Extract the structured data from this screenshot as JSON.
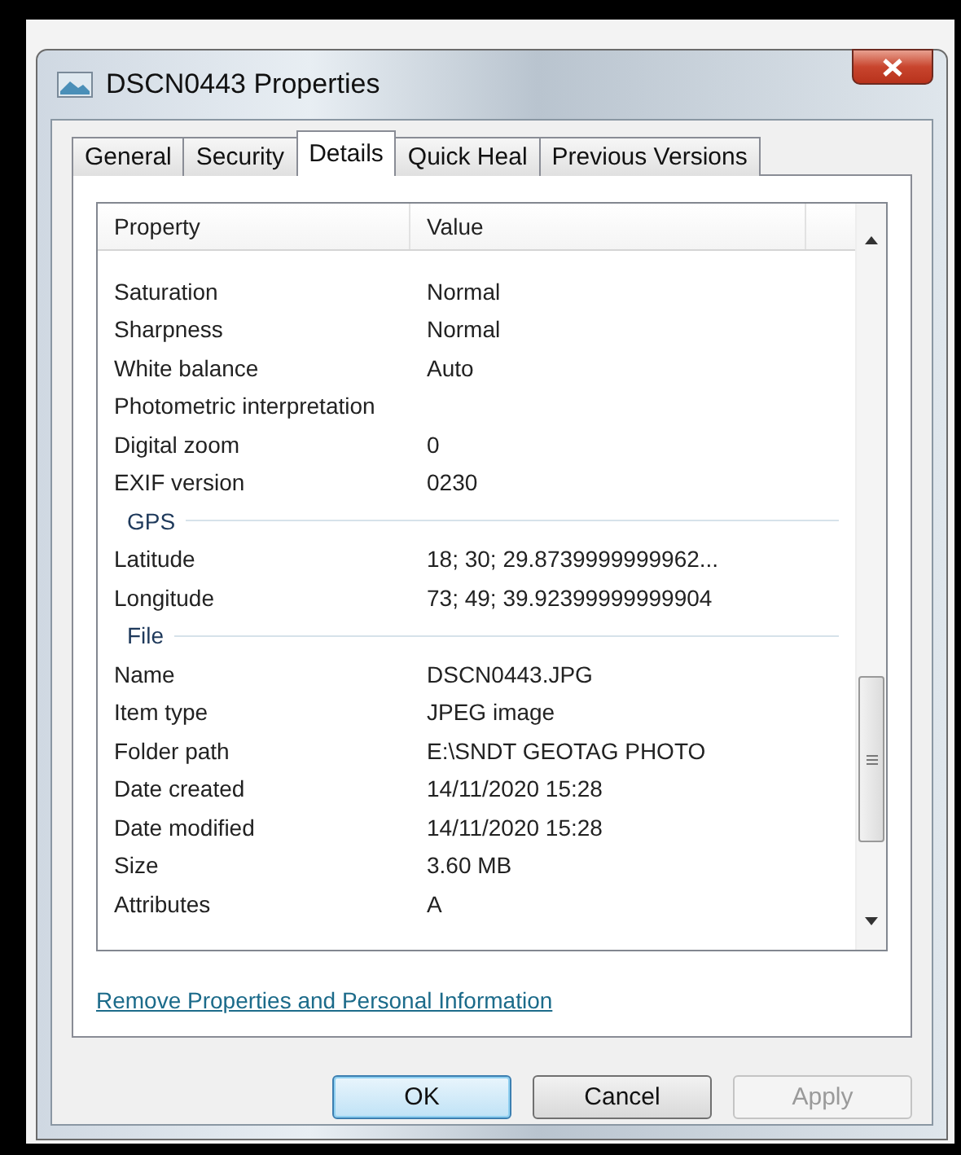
{
  "window": {
    "title": "DSCN0443 Properties"
  },
  "tabs": [
    {
      "label": "General",
      "selected": false
    },
    {
      "label": "Security",
      "selected": false
    },
    {
      "label": "Details",
      "selected": true
    },
    {
      "label": "Quick Heal",
      "selected": false
    },
    {
      "label": "Previous Versions",
      "selected": false
    }
  ],
  "table": {
    "columns": [
      "Property",
      "Value"
    ],
    "rows": [
      {
        "kind": "property",
        "name": "Saturation",
        "value": "Normal"
      },
      {
        "kind": "property",
        "name": "Sharpness",
        "value": "Normal"
      },
      {
        "kind": "property",
        "name": "White balance",
        "value": "Auto"
      },
      {
        "kind": "property",
        "name": "Photometric interpretation"
      },
      {
        "kind": "property",
        "name": "Digital zoom",
        "value": "0"
      },
      {
        "kind": "property",
        "name": "EXIF version",
        "value": "0230"
      },
      {
        "kind": "section",
        "name": "GPS"
      },
      {
        "kind": "property",
        "name": "Latitude",
        "value": "18; 30; 29.8739999999962..."
      },
      {
        "kind": "property",
        "name": "Longitude",
        "value": "73; 49; 39.92399999999904"
      },
      {
        "kind": "section",
        "name": "File"
      },
      {
        "kind": "property",
        "name": "Name",
        "value": "DSCN0443.JPG"
      },
      {
        "kind": "property",
        "name": "Item type",
        "value": "JPEG image"
      },
      {
        "kind": "property",
        "name": "Folder path",
        "value": "E:\\SNDT GEOTAG PHOTO"
      },
      {
        "kind": "property",
        "name": "Date created",
        "value": "14/11/2020 15:28"
      },
      {
        "kind": "property",
        "name": "Date modified",
        "value": "14/11/2020 15:28"
      },
      {
        "kind": "property",
        "name": "Size",
        "value": "3.60 MB"
      },
      {
        "kind": "property",
        "name": "Attributes",
        "value": "A"
      }
    ]
  },
  "link": "Remove Properties and Personal Information",
  "buttons": [
    {
      "label": "OK",
      "default": true,
      "disabled": false
    },
    {
      "label": "Cancel",
      "default": false,
      "disabled": false
    },
    {
      "label": "Apply",
      "default": false,
      "disabled": true
    }
  ]
}
